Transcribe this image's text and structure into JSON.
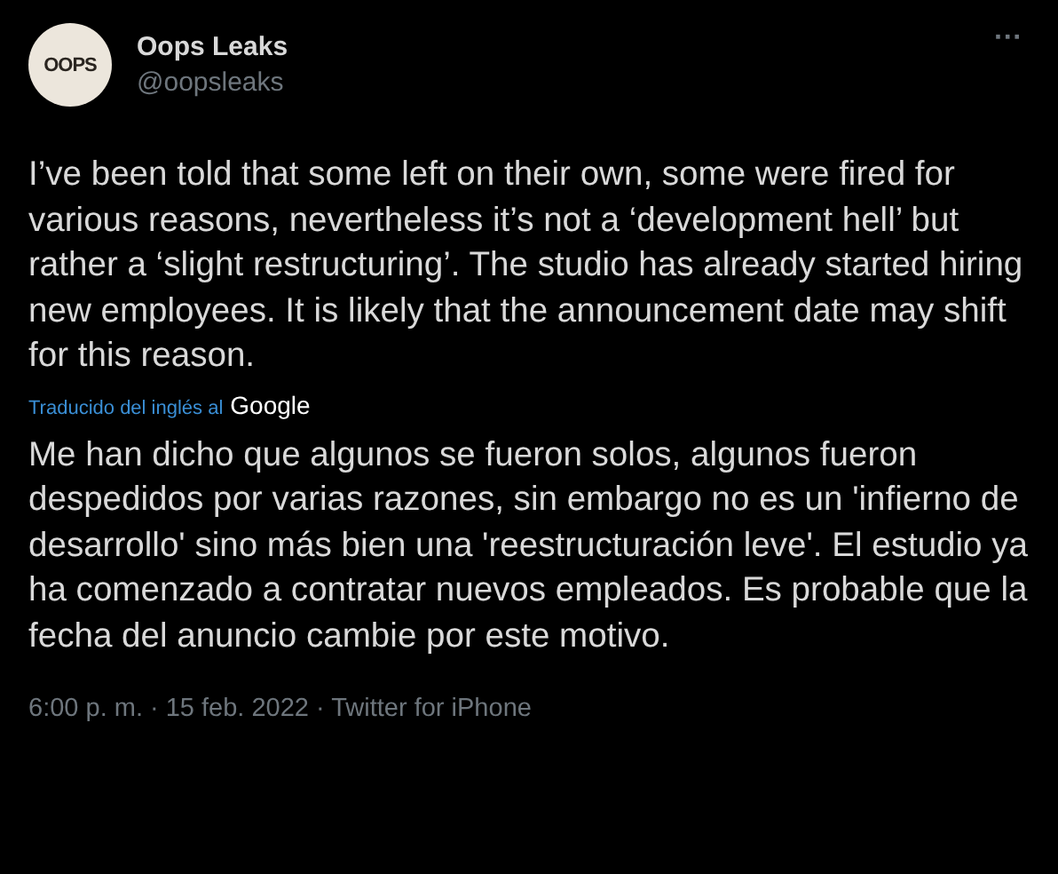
{
  "author": {
    "avatar_text": "OOPS",
    "name": "Oops Leaks",
    "handle": "@oopsleaks"
  },
  "more_label": "···",
  "text": "I’ve been told that some left on their own, some were fired for various reasons, nevertheless it’s not a ‘development hell’ but rather a ‘slight restructuring’. The studio has already started hiring new employees. It is likely that the announcement date may shift for this reason.",
  "translation": {
    "label": "Traducido del inglés al",
    "provider": "Google"
  },
  "translated_text": "Me han dicho que algunos se fueron solos, algunos fueron despedidos por varias razones, sin embargo no es un 'infierno de desarrollo' sino más bien una 'reestructuración leve'. El estudio ya ha comenzado a contratar nuevos empleados. Es probable que la fecha del anuncio cambie por este motivo.",
  "meta": "6:00 p. m. · 15 feb. 2022 · Twitter for iPhone"
}
